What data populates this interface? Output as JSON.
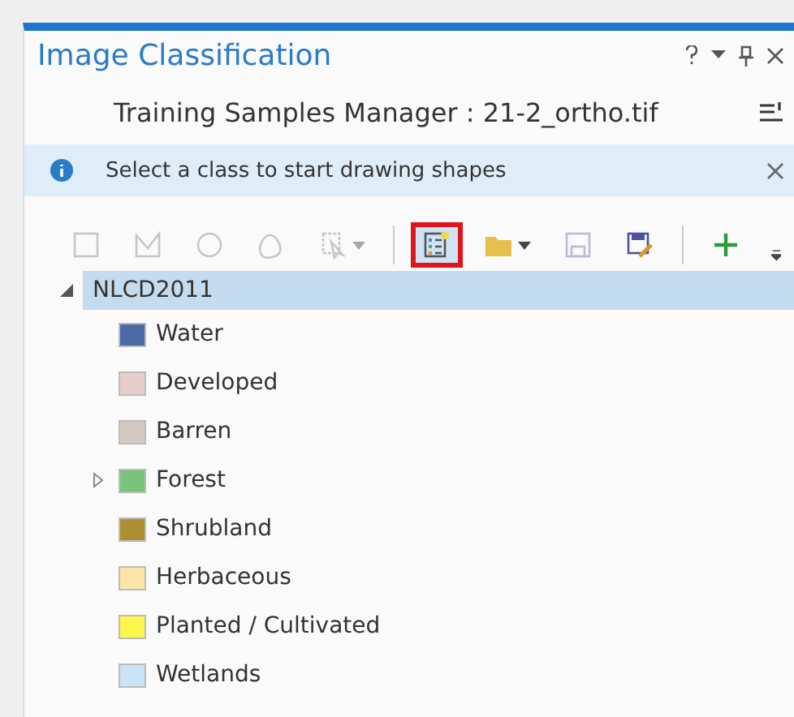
{
  "pane": {
    "title": "Image Classification"
  },
  "manager": {
    "title": "Training Samples Manager : 21-2_ortho.tif"
  },
  "info_bar": {
    "message": "Select a class to start drawing shapes"
  },
  "toolbar": [
    {
      "kind": "rectangle",
      "disabled": true,
      "highlighted": false
    },
    {
      "kind": "polygon",
      "disabled": true,
      "highlighted": false
    },
    {
      "kind": "circle",
      "disabled": true,
      "highlighted": false
    },
    {
      "kind": "freehand",
      "disabled": true,
      "highlighted": false
    },
    {
      "kind": "select",
      "disabled": true,
      "highlighted": false
    },
    {
      "kind": "separator"
    },
    {
      "kind": "classify",
      "disabled": false,
      "highlighted": true
    },
    {
      "kind": "open",
      "disabled": false,
      "highlighted": false
    },
    {
      "kind": "save",
      "disabled": true,
      "highlighted": false
    },
    {
      "kind": "saveas",
      "disabled": false,
      "highlighted": false
    },
    {
      "kind": "separator"
    },
    {
      "kind": "add",
      "disabled": false,
      "highlighted": false
    }
  ],
  "tree": {
    "label": "NLCD2011",
    "expanded": true,
    "selected": true,
    "children": [
      {
        "label": "Water",
        "color": "#4a6aa5",
        "expandable": false
      },
      {
        "label": "Developed",
        "color": "#e8cdcd",
        "expandable": false
      },
      {
        "label": "Barren",
        "color": "#d2cac0",
        "expandable": false
      },
      {
        "label": "Forest",
        "color": "#78c27c",
        "expandable": true
      },
      {
        "label": "Shrubland",
        "color": "#ad9032",
        "expandable": false
      },
      {
        "label": "Herbaceous",
        "color": "#fde4a8",
        "expandable": false
      },
      {
        "label": "Planted / Cultivated",
        "color": "#fdf64c",
        "expandable": false
      },
      {
        "label": "Wetlands",
        "color": "#c9e3f7",
        "expandable": false
      }
    ]
  }
}
